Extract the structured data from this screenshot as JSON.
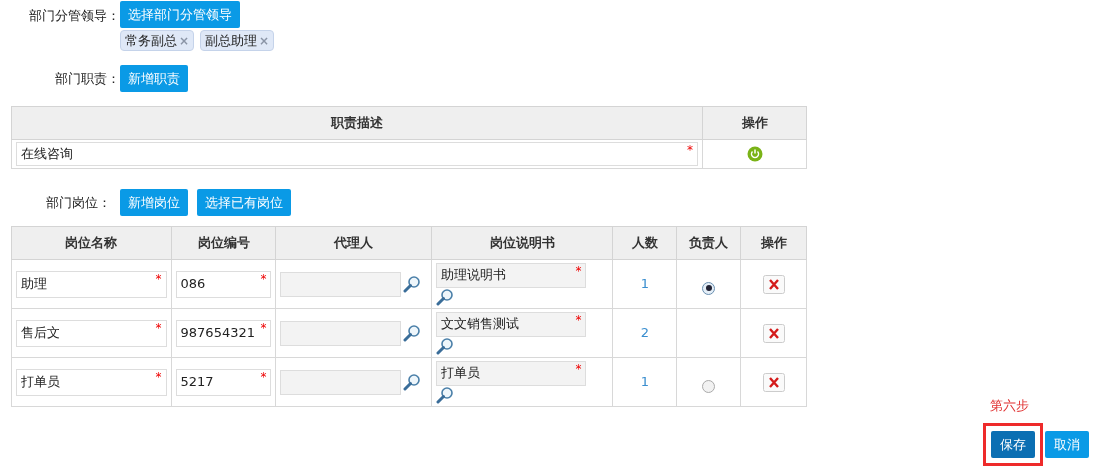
{
  "leaders": {
    "label": "部门分管领导：",
    "button": "选择部门分管领导",
    "tags": [
      {
        "text": "常务副总",
        "remove": "×"
      },
      {
        "text": "副总助理",
        "remove": "×"
      }
    ]
  },
  "duties": {
    "label": "部门职责：",
    "button": "新增职责",
    "columns": [
      "职责描述",
      "操作"
    ],
    "rows": [
      {
        "description": "在线咨询",
        "required_mark": "*"
      }
    ]
  },
  "positions": {
    "label": "部门岗位：",
    "buttons": [
      "新增岗位",
      "选择已有岗位"
    ],
    "columns": [
      "岗位名称",
      "岗位编号",
      "代理人",
      "岗位说明书",
      "人数",
      "负责人",
      "操作"
    ],
    "rows": [
      {
        "name": "助理",
        "name_mark": "*",
        "code": "086",
        "code_mark": "*",
        "doc": "助理说明书",
        "doc_mark": "*",
        "count": "1",
        "selected": true
      },
      {
        "name": "售后文",
        "name_mark": "*",
        "code": "987654321",
        "code_mark": "*",
        "doc": "文文销售测试",
        "doc_mark": "*",
        "count": "2"
      },
      {
        "name": "打单员",
        "name_mark": "*",
        "code": "5217",
        "code_mark": "*",
        "doc": "打单员",
        "doc_mark": "*",
        "count": "1",
        "selected": false
      }
    ]
  },
  "step_note": "第六步",
  "actions": [
    {
      "label": "保存",
      "kind": "primary",
      "highlighted": true
    },
    {
      "label": "取消",
      "kind": "secondary",
      "highlighted": false
    }
  ]
}
